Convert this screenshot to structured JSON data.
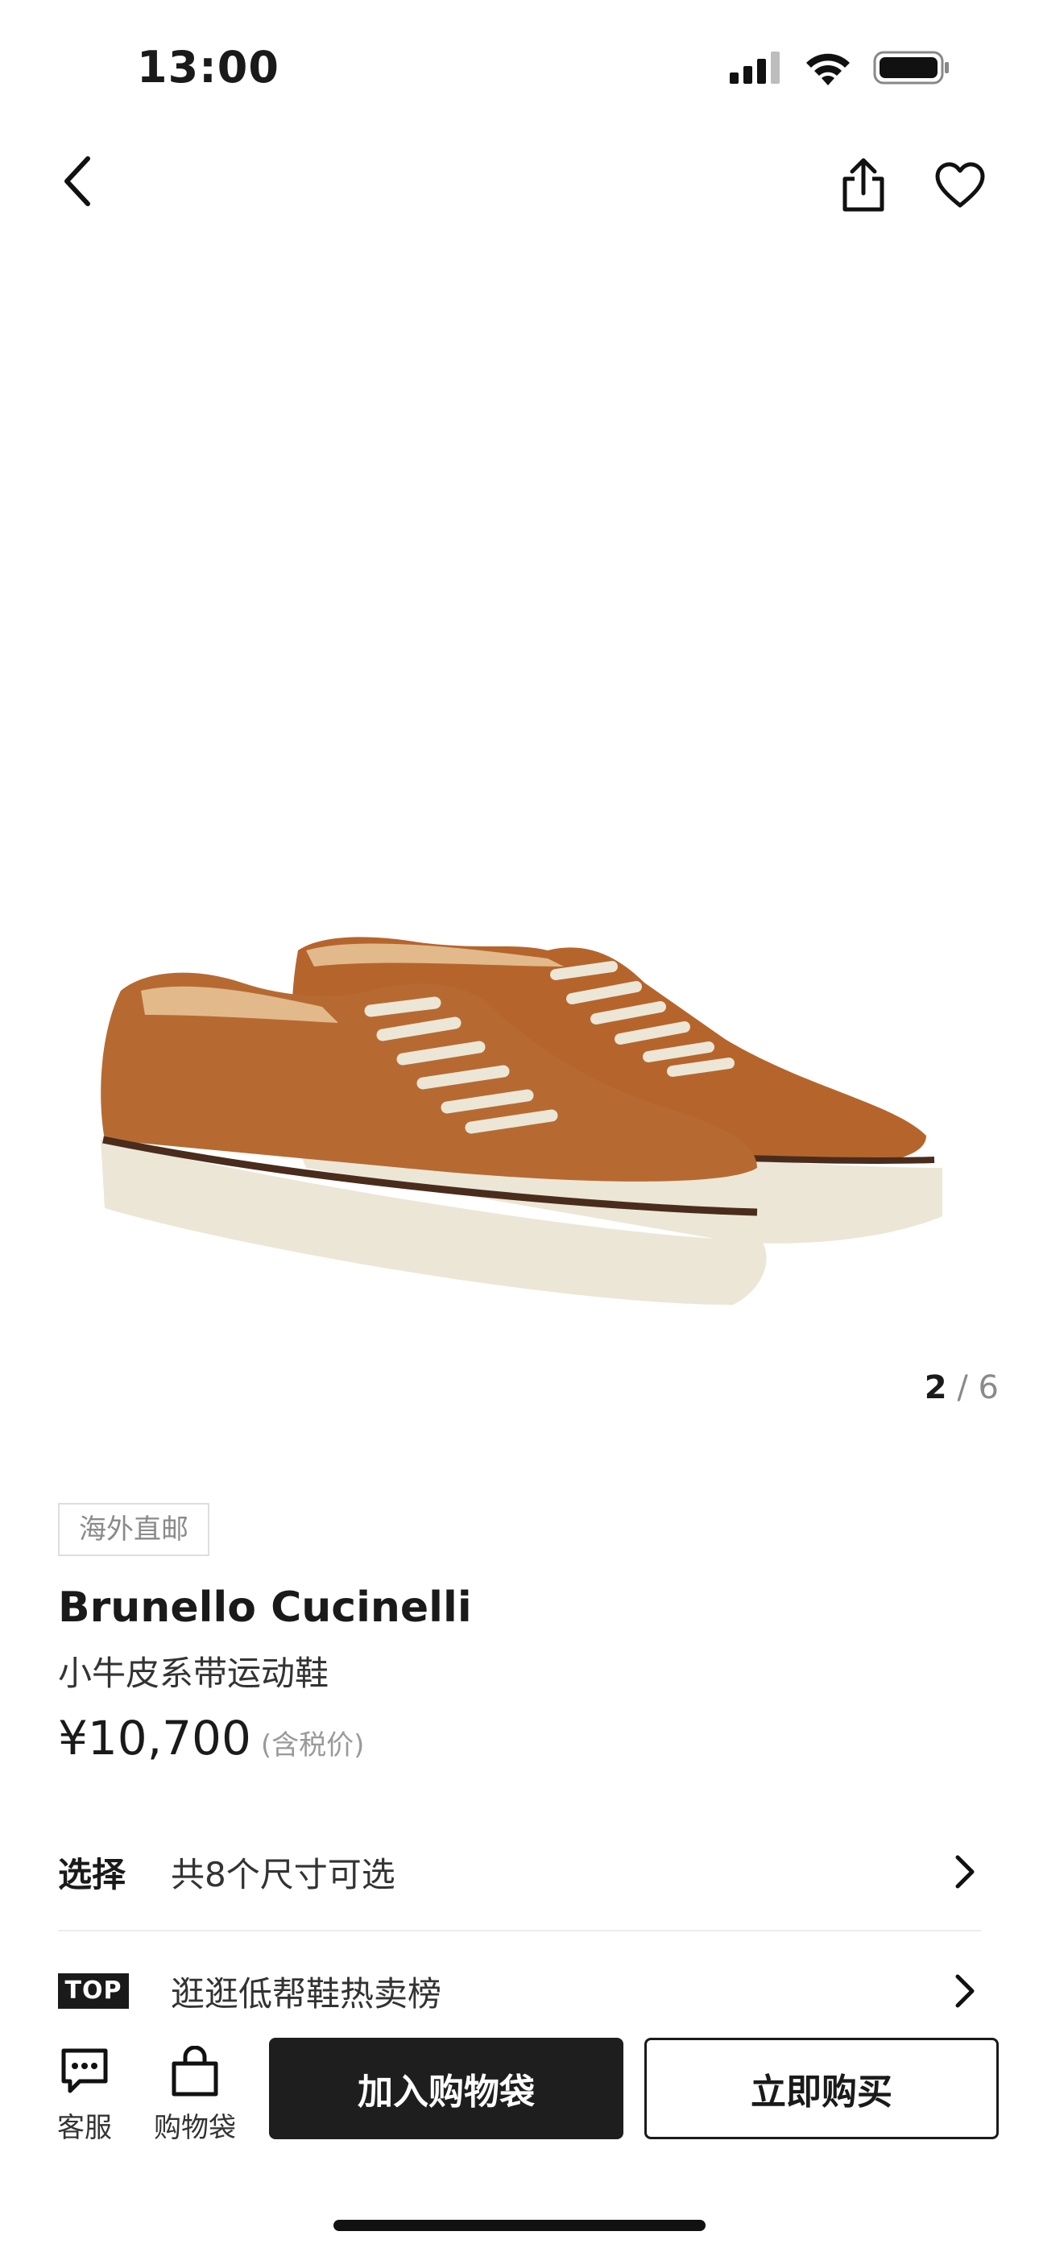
{
  "status_bar": {
    "time": "13:00"
  },
  "nav": {
    "back_icon": "chevron-left-icon",
    "share_icon": "share-icon",
    "favorite_icon": "heart-icon"
  },
  "gallery": {
    "current": "2",
    "separator": "/",
    "total": "6"
  },
  "product": {
    "tag": "海外直邮",
    "brand": "Brunello Cucinelli",
    "name": "小牛皮系带运动鞋",
    "price": "¥10,700",
    "tax_note": "(含税价)"
  },
  "rows": {
    "select_label": "选择",
    "select_text": "共8个尺寸可选",
    "top_badge": "TOP",
    "top_text": "逛逛低帮鞋热卖榜"
  },
  "bottom_bar": {
    "service_label": "客服",
    "bag_label": "购物袋",
    "add_to_bag": "加入购物袋",
    "buy_now": "立即购买"
  },
  "colors": {
    "primary": "#1e1e1e",
    "leather": "#b5652c",
    "sole": "#ece6d6"
  }
}
